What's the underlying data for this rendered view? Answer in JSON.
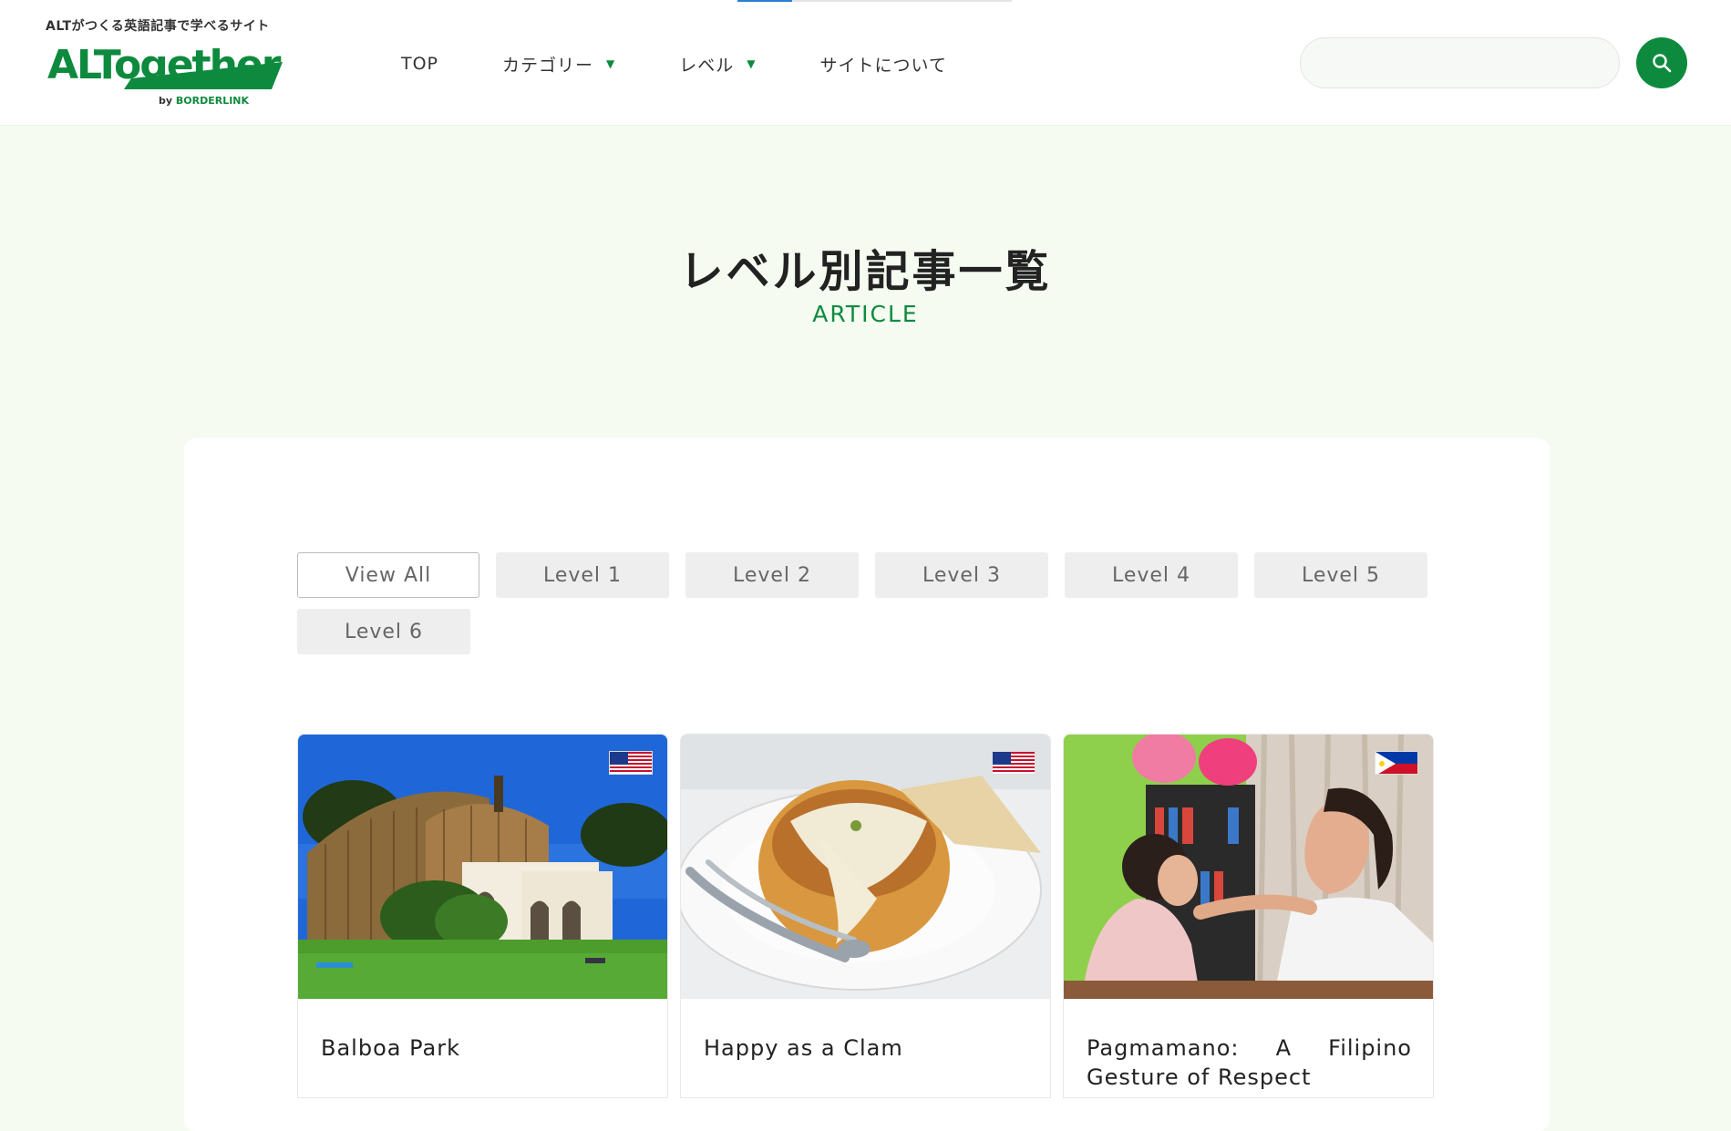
{
  "header": {
    "tagline": "ALTがつくる英語記事で学べるサイト",
    "logo_text": "ALTogether",
    "logo_by_prefix": "by ",
    "logo_by_brand": "BORDERLINK",
    "nav": [
      {
        "label": "TOP",
        "dropdown": false
      },
      {
        "label": "カテゴリー",
        "dropdown": true
      },
      {
        "label": "レベル",
        "dropdown": true
      },
      {
        "label": "サイトについて",
        "dropdown": false
      }
    ],
    "search_placeholder": "",
    "search_icon": "search-icon"
  },
  "hero": {
    "title": "レベル別記事一覧",
    "subtitle": "ARTICLE"
  },
  "filters": [
    {
      "label": "View All",
      "active": true
    },
    {
      "label": "Level 1",
      "active": false
    },
    {
      "label": "Level 2",
      "active": false
    },
    {
      "label": "Level 3",
      "active": false
    },
    {
      "label": "Level 4",
      "active": false
    },
    {
      "label": "Level 5",
      "active": false
    },
    {
      "label": "Level 6",
      "active": false
    }
  ],
  "articles": [
    {
      "title": "Balboa Park",
      "flag": "us-flag-icon"
    },
    {
      "title": "Happy as a Clam",
      "flag": "us-flag-icon"
    },
    {
      "title": "Pagmamano: A Filipino Gesture of Respect",
      "flag": "ph-flag-icon"
    }
  ],
  "colors": {
    "brand_green": "#0e8a3e",
    "page_background": "#f5fbf0",
    "filter_background": "#eeeeee"
  }
}
